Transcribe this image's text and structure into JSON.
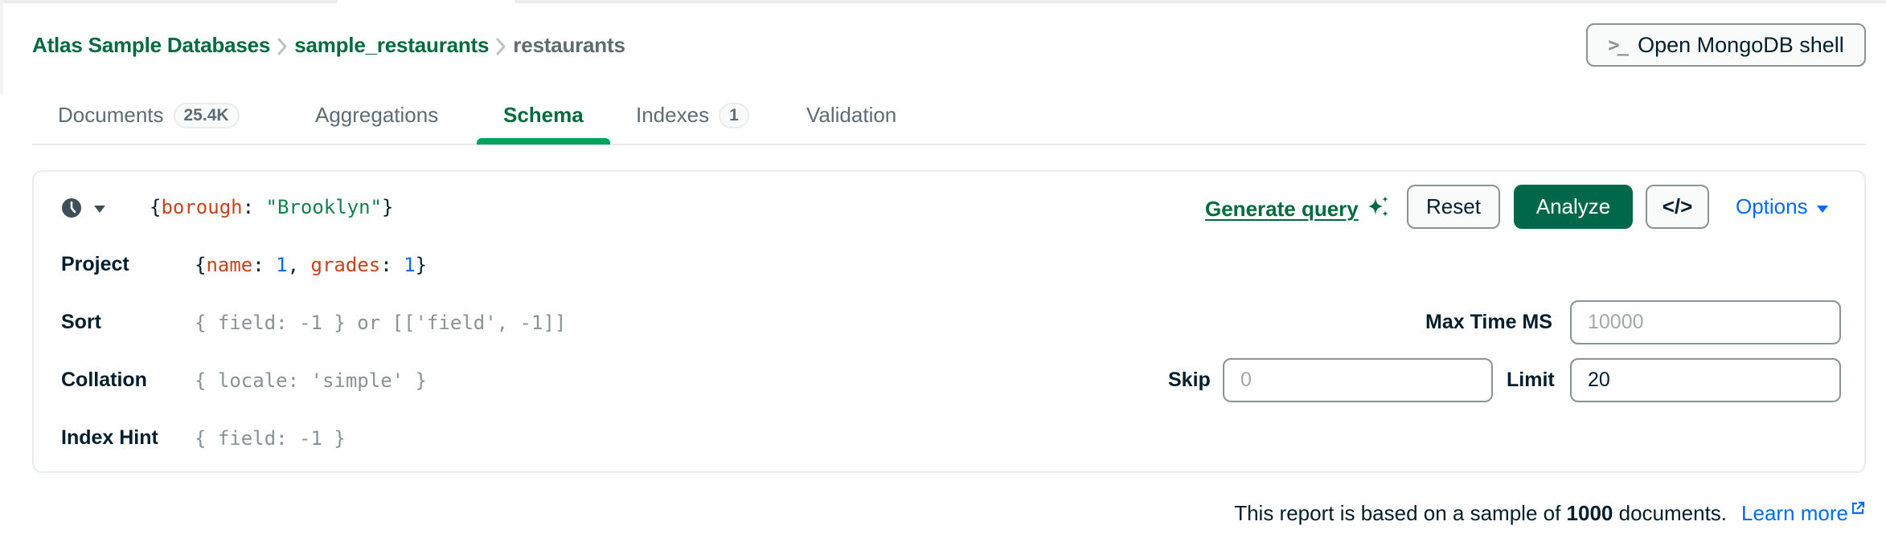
{
  "breadcrumb": {
    "items": [
      "Atlas Sample Databases",
      "sample_restaurants",
      "restaurants"
    ]
  },
  "shell_button": {
    "icon": "terminal-prompt-icon",
    "prompt_glyph": ">_",
    "label": "Open MongoDB shell"
  },
  "tabs": [
    {
      "label": "Documents",
      "badge": "25.4K",
      "active": false
    },
    {
      "label": "Aggregations",
      "active": false
    },
    {
      "label": "Schema",
      "active": true
    },
    {
      "label": "Indexes",
      "badge": "1",
      "active": false
    },
    {
      "label": "Validation",
      "active": false
    }
  ],
  "query_bar": {
    "history_icon": "clock-icon",
    "filter": {
      "open": "{",
      "key": "borough",
      "colon": ": ",
      "value": "\"Brooklyn\"",
      "close": "}"
    },
    "generate_query_label": "Generate query",
    "generate_query_icon": "sparkle-icon",
    "reset_label": "Reset",
    "analyze_label": "Analyze",
    "code_label": "</>",
    "options_label": "Options",
    "project": {
      "label": "Project",
      "parts": {
        "open": "{",
        "k1": "name",
        "c1": ": ",
        "v1": "1",
        "sep": ", ",
        "k2": "grades",
        "c2": ": ",
        "v2": "1",
        "close": "}"
      }
    },
    "sort": {
      "label": "Sort",
      "placeholder": "{ field: -1 } or [['field', -1]]"
    },
    "collation": {
      "label": "Collation",
      "placeholder": "{ locale: 'simple' }"
    },
    "index_hint": {
      "label": "Index Hint",
      "placeholder": "{ field: -1 }"
    },
    "max_time_ms": {
      "label": "Max Time MS",
      "placeholder": "10000",
      "value": ""
    },
    "skip": {
      "label": "Skip",
      "placeholder": "0",
      "value": ""
    },
    "limit": {
      "label": "Limit",
      "placeholder": "",
      "value": "20"
    }
  },
  "footer": {
    "prefix": "This report is based on a sample of ",
    "count": "1000",
    "suffix": " documents.",
    "learn_more": "Learn more",
    "learn_more_icon": "external-link-icon"
  },
  "colors": {
    "brand_green": "#016b3e",
    "active_tab_indicator": "#00a35c",
    "primary_button": "#00684a",
    "link_blue": "#016bf8",
    "json_key": "#c5441c",
    "json_string": "#12824d"
  }
}
